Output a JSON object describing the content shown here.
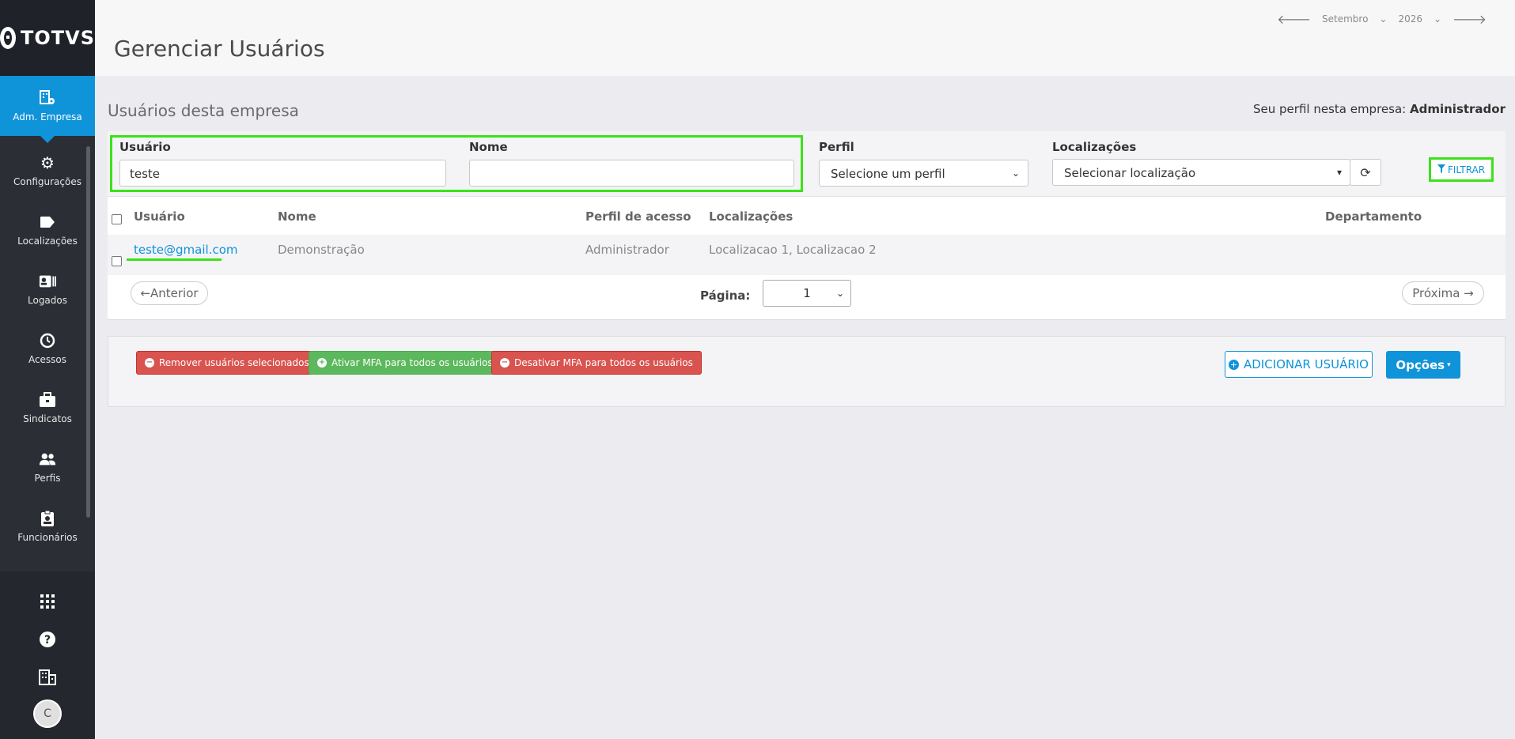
{
  "sidebar": {
    "logo_text": "TOTVS",
    "items": [
      {
        "label": "Adm. Empresa",
        "icon": "building-settings-icon",
        "active": true
      },
      {
        "label": "Configurações",
        "icon": "gear-icon"
      },
      {
        "label": "Localizações",
        "icon": "tag-icon"
      },
      {
        "label": "Logados",
        "icon": "id-card-icon"
      },
      {
        "label": "Acessos",
        "icon": "history-icon"
      },
      {
        "label": "Sindicatos",
        "icon": "briefcase-icon"
      },
      {
        "label": "Perfis",
        "icon": "users-icon"
      },
      {
        "label": "Funcionários",
        "icon": "badge-icon"
      }
    ],
    "bottom": {
      "apps_icon": "grid-icon",
      "help_icon": "help-icon",
      "company_icon": "company-icon",
      "avatar_initial": "C"
    }
  },
  "header": {
    "title": "Gerenciar Usuários",
    "month": "Setembro",
    "year": "2026"
  },
  "main": {
    "section_title": "Usuários desta empresa",
    "profile_prefix": "Seu perfil nesta empresa:",
    "profile_value": "Administrador",
    "filters": {
      "usuario_label": "Usuário",
      "usuario_value": "teste",
      "nome_label": "Nome",
      "nome_value": "",
      "perfil_label": "Perfil",
      "perfil_value": "Selecione um perfil",
      "localizacoes_label": "Localizações",
      "localizacoes_value": "Selecionar localização",
      "filter_button": "FILTRAR"
    },
    "table": {
      "columns": [
        "Usuário",
        "Nome",
        "Perfil de acesso",
        "Localizações",
        "Departamento"
      ],
      "rows": [
        {
          "usuario": "teste@gmail.com",
          "nome": "Demonstração",
          "perfil": "Administrador",
          "localizacoes": "Localizacao 1, Localizacao 2",
          "departamento": ""
        }
      ]
    },
    "pagination": {
      "prev": "←Anterior",
      "page_label": "Página:",
      "page_value": "1",
      "next": "Próxima →"
    },
    "actions": {
      "remove": "Remover usuários selecionados",
      "enable_mfa": "Ativar MFA para todos os usuários",
      "disable_mfa": "Desativar MFA para todos os usuários",
      "add_user": "ADICIONAR USUÁRIO",
      "options": "Opções"
    }
  },
  "colors": {
    "accent": "#0f93d9",
    "highlight": "#3be21a",
    "danger": "#d9534f",
    "success": "#5cb85c",
    "sidebar": "#2b2e35"
  }
}
